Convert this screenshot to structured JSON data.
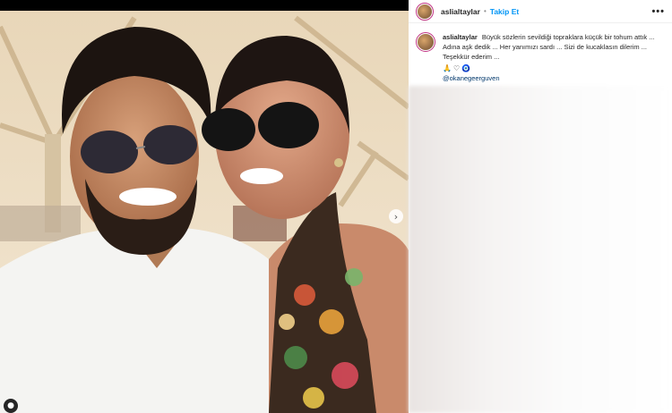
{
  "post": {
    "username": "aslialtaylar",
    "separator": "•",
    "follow_label": "Takip Et",
    "more_label": "•••",
    "caption": "Büyük sözlerin sevildiği topraklara küçük bir tohum attık ... Adına aşk dedik ... Her yanımızı sardı ... Sizi de kucaklasın dilerim ... Teşekkür ederim ...",
    "emojis": [
      "🙏",
      "♡",
      "🧿"
    ],
    "mention": "@okanegeerguven",
    "next_icon": "›",
    "tag_icon": "●"
  },
  "colors": {
    "accent": "#0095f6",
    "mention": "#00376b"
  }
}
